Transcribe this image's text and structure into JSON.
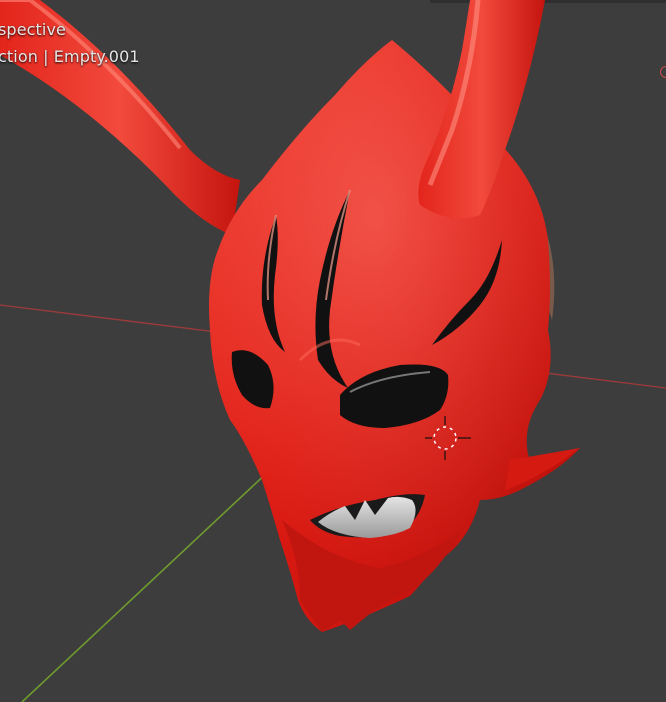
{
  "viewport": {
    "view_title": "spective",
    "collection_info": "ction | Empty.001",
    "grid_visible": true,
    "axis_colors": {
      "x_axis": "#a03a3a",
      "y_axis": "#6e9a2e"
    },
    "background_color": "#3d3d3d"
  },
  "model": {
    "object": "oni mask",
    "material_color": "#e01b14",
    "eye_color": "#111111",
    "teeth_color": "#c8c8c8",
    "origin_icon": "3d-cursor-icon"
  }
}
